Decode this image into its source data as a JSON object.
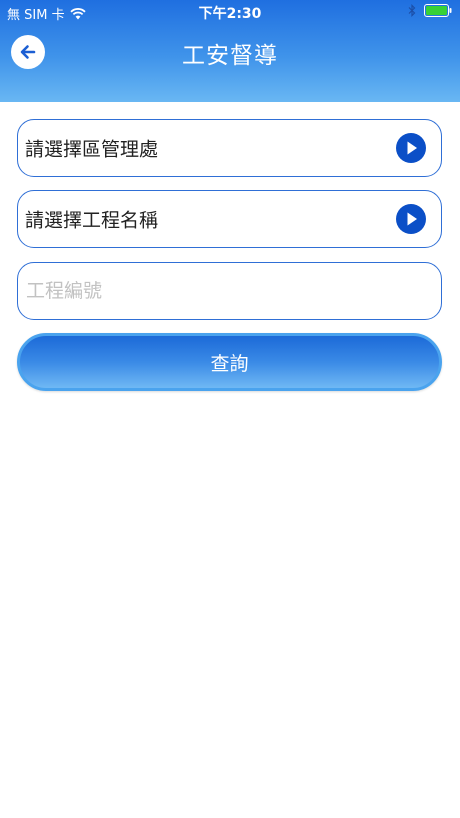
{
  "status_bar": {
    "carrier": "無 SIM 卡",
    "time": "下午2:30"
  },
  "header": {
    "title": "工安督導"
  },
  "form": {
    "district_select_label": "請選擇區管理處",
    "project_select_label": "請選擇工程名稱",
    "project_number_placeholder": "工程編號",
    "project_number_value": "",
    "query_button_label": "查詢"
  },
  "colors": {
    "accent": "#2f6fd6",
    "header_top": "#1f6fe0",
    "header_bottom": "#69b7f3",
    "arrow_circle": "#0b4fc7",
    "battery": "#37d137"
  }
}
